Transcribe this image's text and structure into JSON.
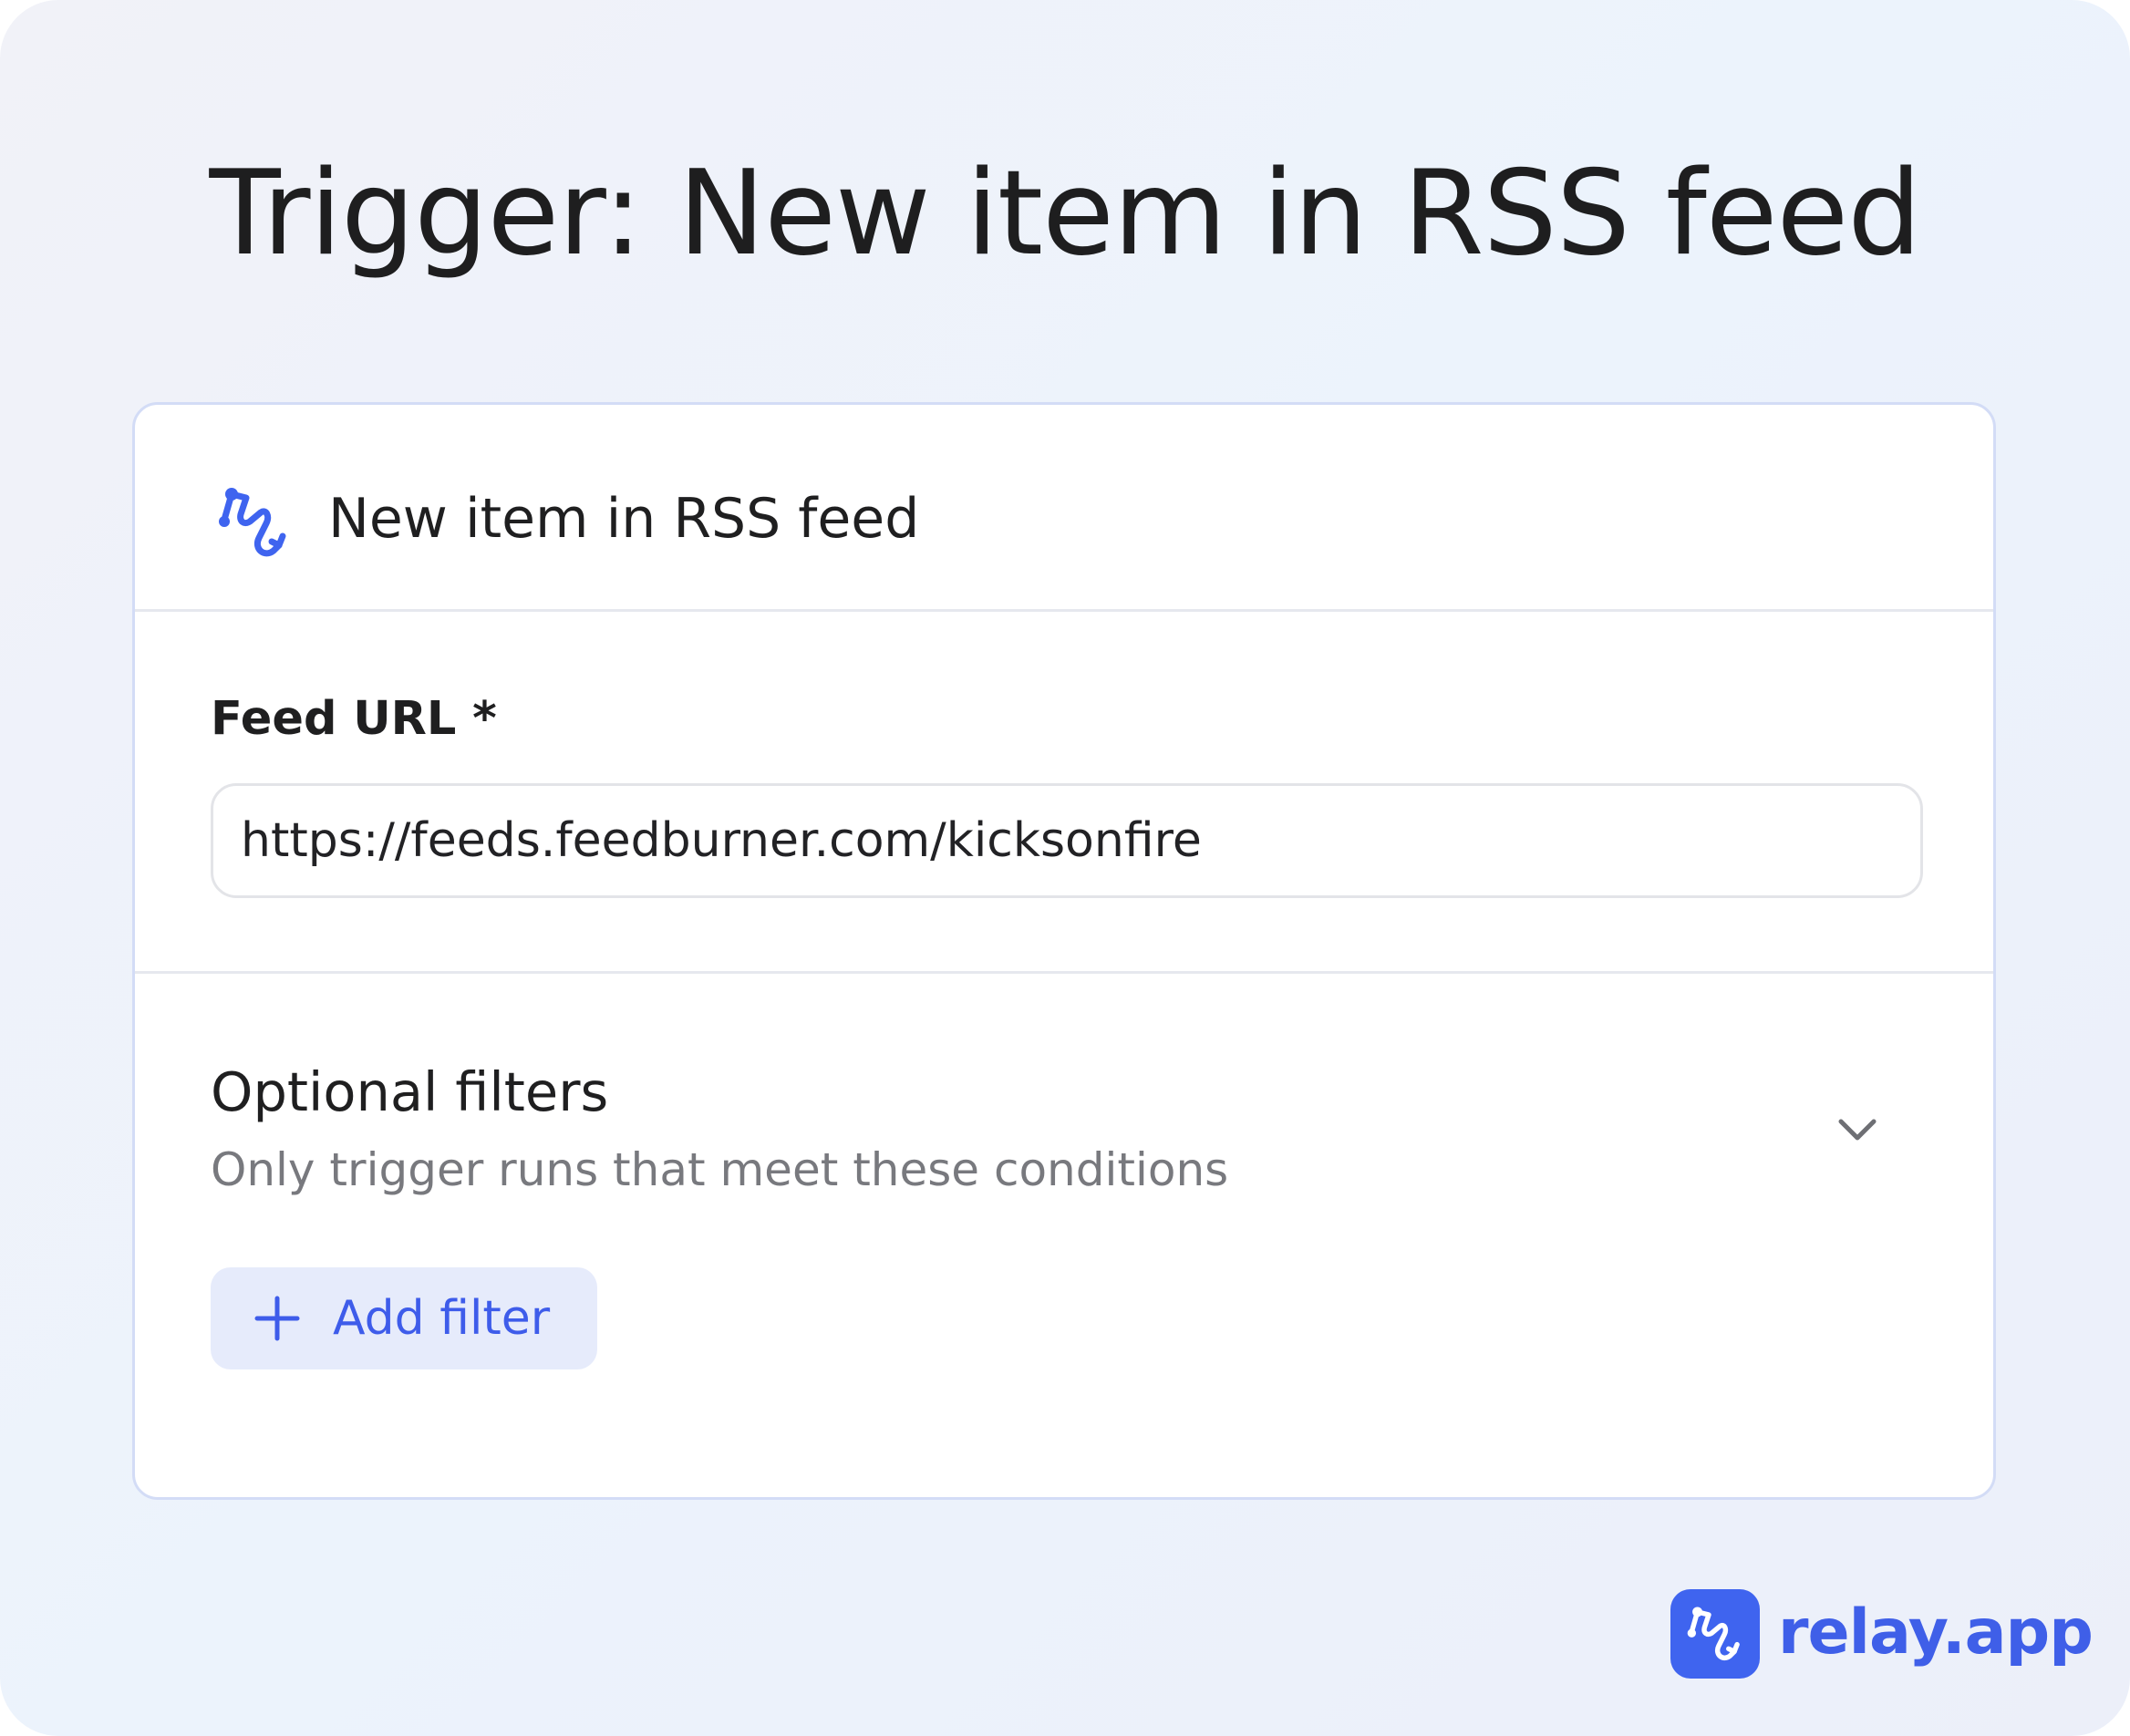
{
  "page": {
    "title": "Trigger: New item in RSS feed"
  },
  "card": {
    "header": {
      "icon": "relay-trigger-icon",
      "title": "New item in RSS feed"
    },
    "feed_url": {
      "label": "Feed URL *",
      "value": "https://feeds.feedburner.com/kicksonfire"
    },
    "filters": {
      "title": "Optional filters",
      "subtitle": "Only trigger runs that meet these conditions",
      "toggle_icon": "chevron-down-icon",
      "add_button": {
        "icon": "plus-icon",
        "label": "Add filter"
      }
    }
  },
  "brand": {
    "logo_icon": "relay-logo-icon",
    "name": "relay.app"
  },
  "colors": {
    "accent": "#3f64ef",
    "accent_text": "#3e5cea",
    "button_bg": "#e6ebfb",
    "card_border": "#d3dcf6",
    "text_primary": "#1f1f20",
    "text_secondary": "#78797e"
  }
}
